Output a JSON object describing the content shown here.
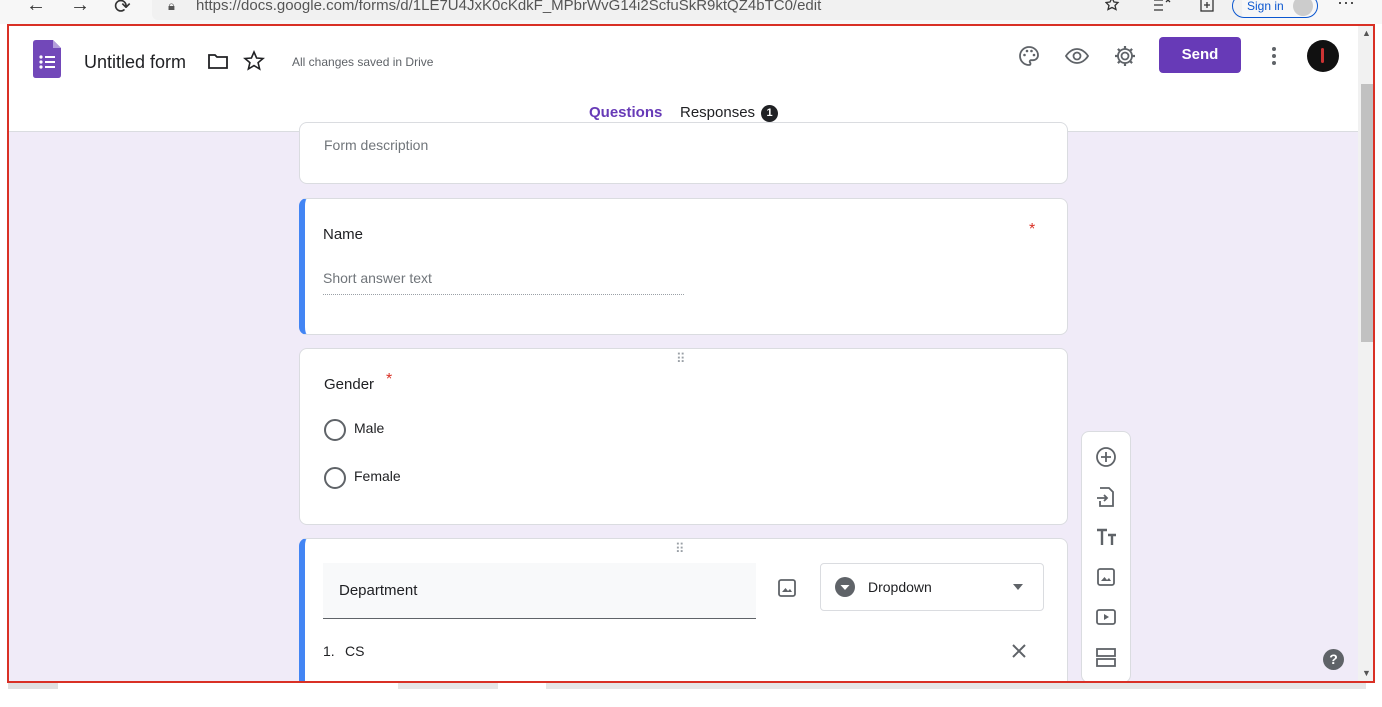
{
  "browser": {
    "url": "https://docs.google.com/forms/d/1LE7U4JxK0cKdkF_MPbrWvG14i2ScfuSkR9ktQZ4bTC0/edit",
    "signin_label": "Sign in",
    "more_label": "···"
  },
  "header": {
    "form_title": "Untitled form",
    "save_status": "All changes saved in Drive",
    "send_label": "Send"
  },
  "tabs": {
    "questions": "Questions",
    "responses": "Responses",
    "responses_count": "1"
  },
  "form": {
    "description_placeholder": "Form description"
  },
  "questions": {
    "name": {
      "title": "Name",
      "required_mark": "*",
      "placeholder": "Short answer text"
    },
    "gender": {
      "title": "Gender",
      "required_mark": "*",
      "options": [
        "Male",
        "Female"
      ]
    },
    "department": {
      "title": "Department",
      "type_label": "Dropdown",
      "option_1_number": "1.",
      "option_1": "CS"
    }
  },
  "help_label": "?",
  "colors": {
    "accent": "#673ab7",
    "active_card": "#4285f4",
    "background": "#f0ebf8",
    "required": "#d93025"
  },
  "icons": [
    "palette-icon",
    "preview-eye-icon",
    "settings-gear-icon",
    "more-vert-icon",
    "folder-icon",
    "star-icon",
    "add-question-icon",
    "import-questions-icon",
    "add-title-icon",
    "add-image-icon",
    "add-video-icon",
    "add-section-icon",
    "image-icon",
    "close-icon",
    "dropdown-circle-icon",
    "help-icon"
  ]
}
